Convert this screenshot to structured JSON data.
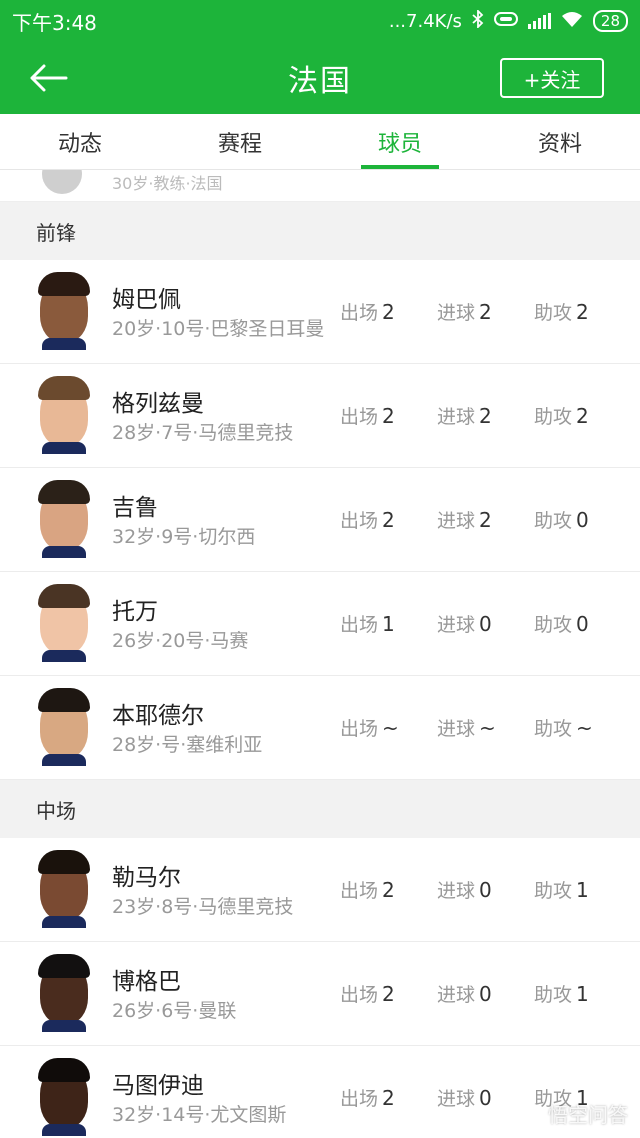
{
  "status_bar": {
    "time": "下午3:48",
    "network_speed": "...7.4K/s",
    "battery": "28",
    "icons": [
      "bluetooth-icon",
      "headphones-icon",
      "signal-icon",
      "wifi-icon",
      "battery-icon"
    ]
  },
  "header": {
    "title": "法国",
    "follow_label": "+关注",
    "back_icon": "arrow-left-icon"
  },
  "tabs": [
    {
      "label": "动态",
      "active": false
    },
    {
      "label": "赛程",
      "active": false
    },
    {
      "label": "球员",
      "active": true
    },
    {
      "label": "资料",
      "active": false
    }
  ],
  "partial_row": {
    "meta": "30岁·教练·法国"
  },
  "sections": [
    {
      "title": "前锋",
      "players": [
        {
          "name": "姆巴佩",
          "meta": "20岁·10号·巴黎圣日耳曼",
          "apps_label": "出场",
          "apps": "2",
          "goals_label": "进球",
          "goals": "2",
          "assists_label": "助攻",
          "assists": "2"
        },
        {
          "name": "格列兹曼",
          "meta": "28岁·7号·马德里竞技",
          "apps_label": "出场",
          "apps": "2",
          "goals_label": "进球",
          "goals": "2",
          "assists_label": "助攻",
          "assists": "2"
        },
        {
          "name": "吉鲁",
          "meta": "32岁·9号·切尔西",
          "apps_label": "出场",
          "apps": "2",
          "goals_label": "进球",
          "goals": "2",
          "assists_label": "助攻",
          "assists": "0"
        },
        {
          "name": "托万",
          "meta": "26岁·20号·马赛",
          "apps_label": "出场",
          "apps": "1",
          "goals_label": "进球",
          "goals": "0",
          "assists_label": "助攻",
          "assists": "0"
        },
        {
          "name": "本耶德尔",
          "meta": "28岁·号·塞维利亚",
          "apps_label": "出场",
          "apps": "~",
          "goals_label": "进球",
          "goals": "~",
          "assists_label": "助攻",
          "assists": "~"
        }
      ]
    },
    {
      "title": "中场",
      "players": [
        {
          "name": "勒马尔",
          "meta": "23岁·8号·马德里竞技",
          "apps_label": "出场",
          "apps": "2",
          "goals_label": "进球",
          "goals": "0",
          "assists_label": "助攻",
          "assists": "1"
        },
        {
          "name": "博格巴",
          "meta": "26岁·6号·曼联",
          "apps_label": "出场",
          "apps": "2",
          "goals_label": "进球",
          "goals": "0",
          "assists_label": "助攻",
          "assists": "1"
        },
        {
          "name": "马图伊迪",
          "meta": "32岁·14号·尤文图斯",
          "apps_label": "出场",
          "apps": "2",
          "goals_label": "进球",
          "goals": "0",
          "assists_label": "助攻",
          "assists": "1"
        }
      ]
    }
  ],
  "colors": {
    "accent": "#1db43a"
  },
  "watermark": "悟空问答"
}
